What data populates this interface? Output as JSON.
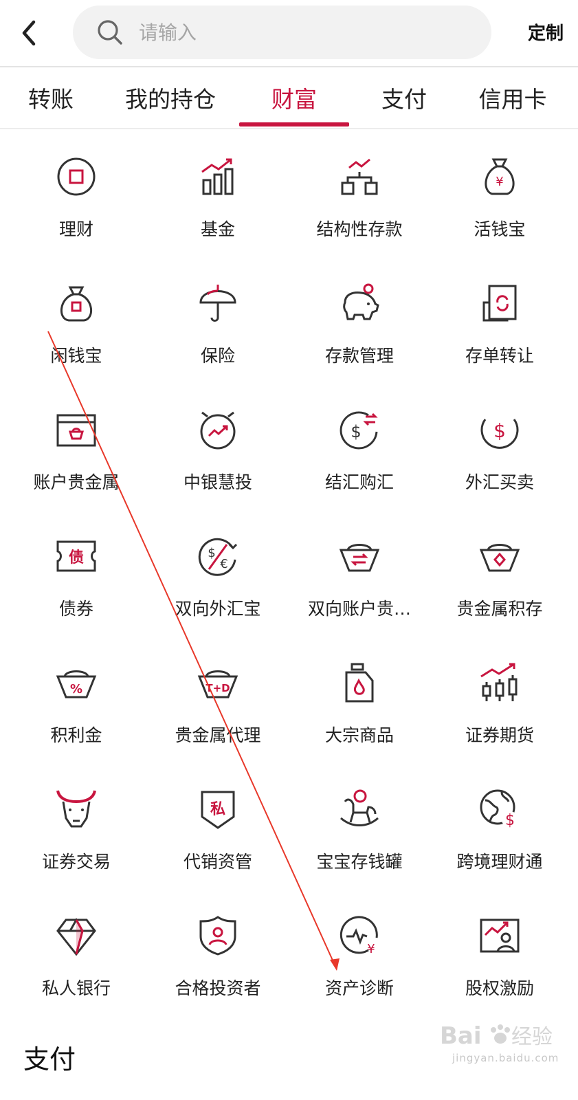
{
  "header": {
    "search_placeholder": "请输入",
    "custom_label": "定制"
  },
  "tabs": [
    {
      "label": "转账"
    },
    {
      "label": "我的持仓"
    },
    {
      "label": "财富",
      "active": true
    },
    {
      "label": "支付"
    },
    {
      "label": "信用卡"
    }
  ],
  "grid": {
    "items": [
      {
        "label": "理财",
        "icon": "wealth-management-icon"
      },
      {
        "label": "基金",
        "icon": "fund-chart-icon"
      },
      {
        "label": "结构性存款",
        "icon": "structured-deposit-icon"
      },
      {
        "label": "活钱宝",
        "icon": "money-bag-yuan-icon"
      },
      {
        "label": "闲钱宝",
        "icon": "money-bag-coin-icon"
      },
      {
        "label": "保险",
        "icon": "umbrella-icon"
      },
      {
        "label": "存款管理",
        "icon": "piggy-bank-icon"
      },
      {
        "label": "存单转让",
        "icon": "certificate-transfer-icon"
      },
      {
        "label": "账户贵金属",
        "icon": "gold-card-icon"
      },
      {
        "label": "中银慧投",
        "icon": "alarm-trend-icon"
      },
      {
        "label": "结汇购汇",
        "icon": "dollar-exchange-icon"
      },
      {
        "label": "外汇买卖",
        "icon": "dollar-circle-icon"
      },
      {
        "label": "债券",
        "icon": "bond-ticket-icon"
      },
      {
        "label": "双向外汇宝",
        "icon": "dollar-euro-icon"
      },
      {
        "label": "双向账户贵…",
        "icon": "gold-ingot-exchange-icon"
      },
      {
        "label": "贵金属积存",
        "icon": "gold-ingot-diamond-icon"
      },
      {
        "label": "积利金",
        "icon": "gold-ingot-percent-icon"
      },
      {
        "label": "贵金属代理",
        "icon": "gold-ingot-td-icon"
      },
      {
        "label": "大宗商品",
        "icon": "oil-can-icon"
      },
      {
        "label": "证券期货",
        "icon": "candlestick-icon"
      },
      {
        "label": "证券交易",
        "icon": "bull-icon"
      },
      {
        "label": "代销资管",
        "icon": "private-shield-icon"
      },
      {
        "label": "宝宝存钱罐",
        "icon": "rocking-horse-icon"
      },
      {
        "label": "跨境理财通",
        "icon": "globe-dollar-icon"
      },
      {
        "label": "私人银行",
        "icon": "diamond-icon"
      },
      {
        "label": "合格投资者",
        "icon": "shield-user-icon"
      },
      {
        "label": "资产诊断",
        "icon": "asset-diagnosis-icon"
      },
      {
        "label": "股权激励",
        "icon": "equity-incentive-icon"
      }
    ]
  },
  "section_title": "支付",
  "colors": {
    "accent": "#c8153f",
    "text": "#222222",
    "icon_stroke": "#333333",
    "search_bg": "#f2f2f2",
    "annotation_line": "#e8382a"
  },
  "watermark": {
    "text": "jingyan.baidu.com"
  }
}
